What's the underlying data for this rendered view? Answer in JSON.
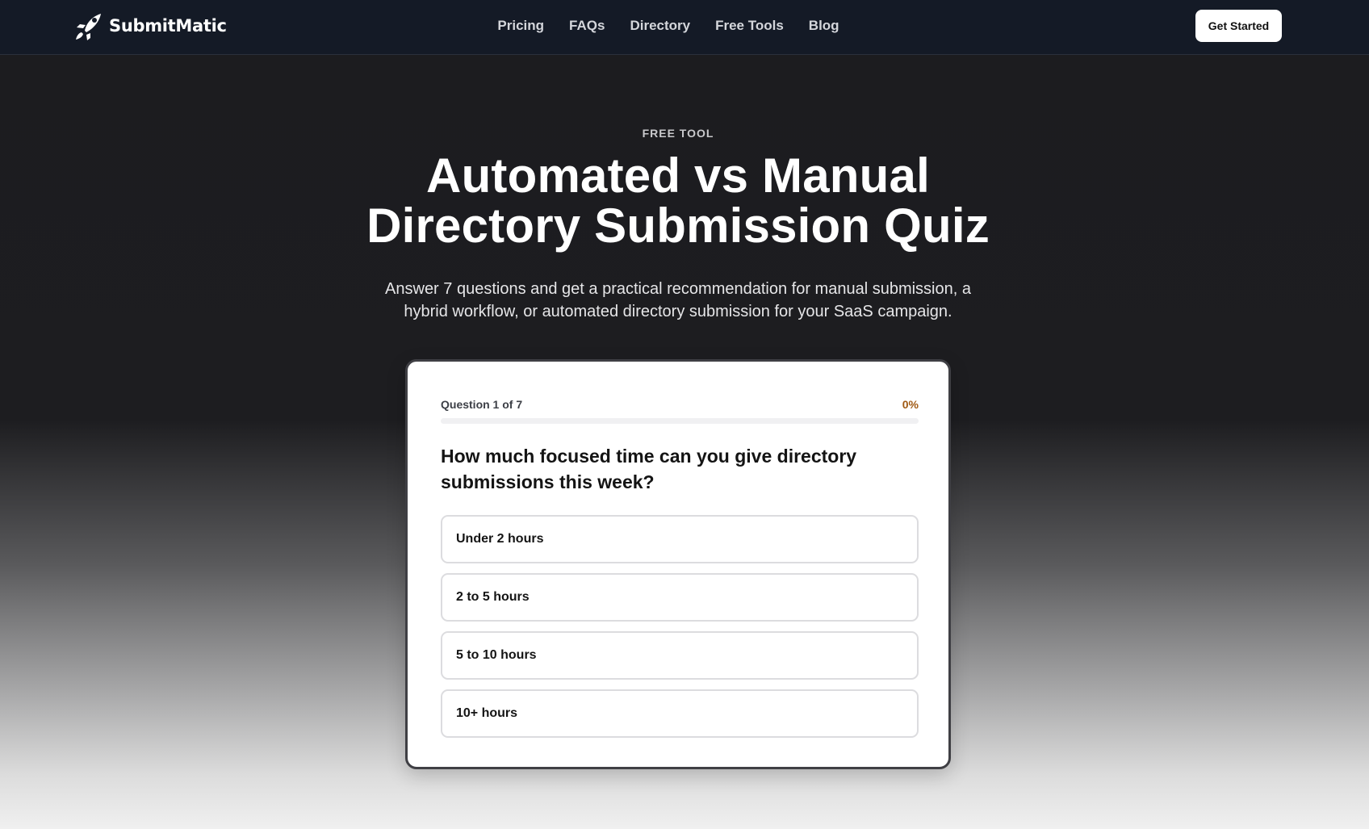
{
  "nav": {
    "brand": "SubmitMatic",
    "links": [
      "Pricing",
      "FAQs",
      "Directory",
      "Free Tools",
      "Blog"
    ],
    "cta": "Get Started"
  },
  "hero": {
    "eyebrow": "FREE TOOL",
    "title_line1": "Automated vs Manual",
    "title_line2": "Directory Submission Quiz",
    "subtitle_line1": "Answer 7 questions and get a practical recommendation for manual submission, a",
    "subtitle_line2": "hybrid workflow, or automated directory submission for your SaaS campaign."
  },
  "quiz": {
    "progress_label": "Question 1 of 7",
    "progress_percent": "0%",
    "progress_value": 0,
    "question": "How much focused time can you give directory submissions this week?",
    "options": [
      "Under 2 hours",
      "2 to 5 hours",
      "5 to 10 hours",
      "10+ hours"
    ]
  },
  "colors": {
    "navbar": "#141a26",
    "hero_background": "#1c1c1f",
    "accent": "#a05a14",
    "card": "#ffffff"
  },
  "icons": {
    "brand_logo": "rocket-icon"
  }
}
